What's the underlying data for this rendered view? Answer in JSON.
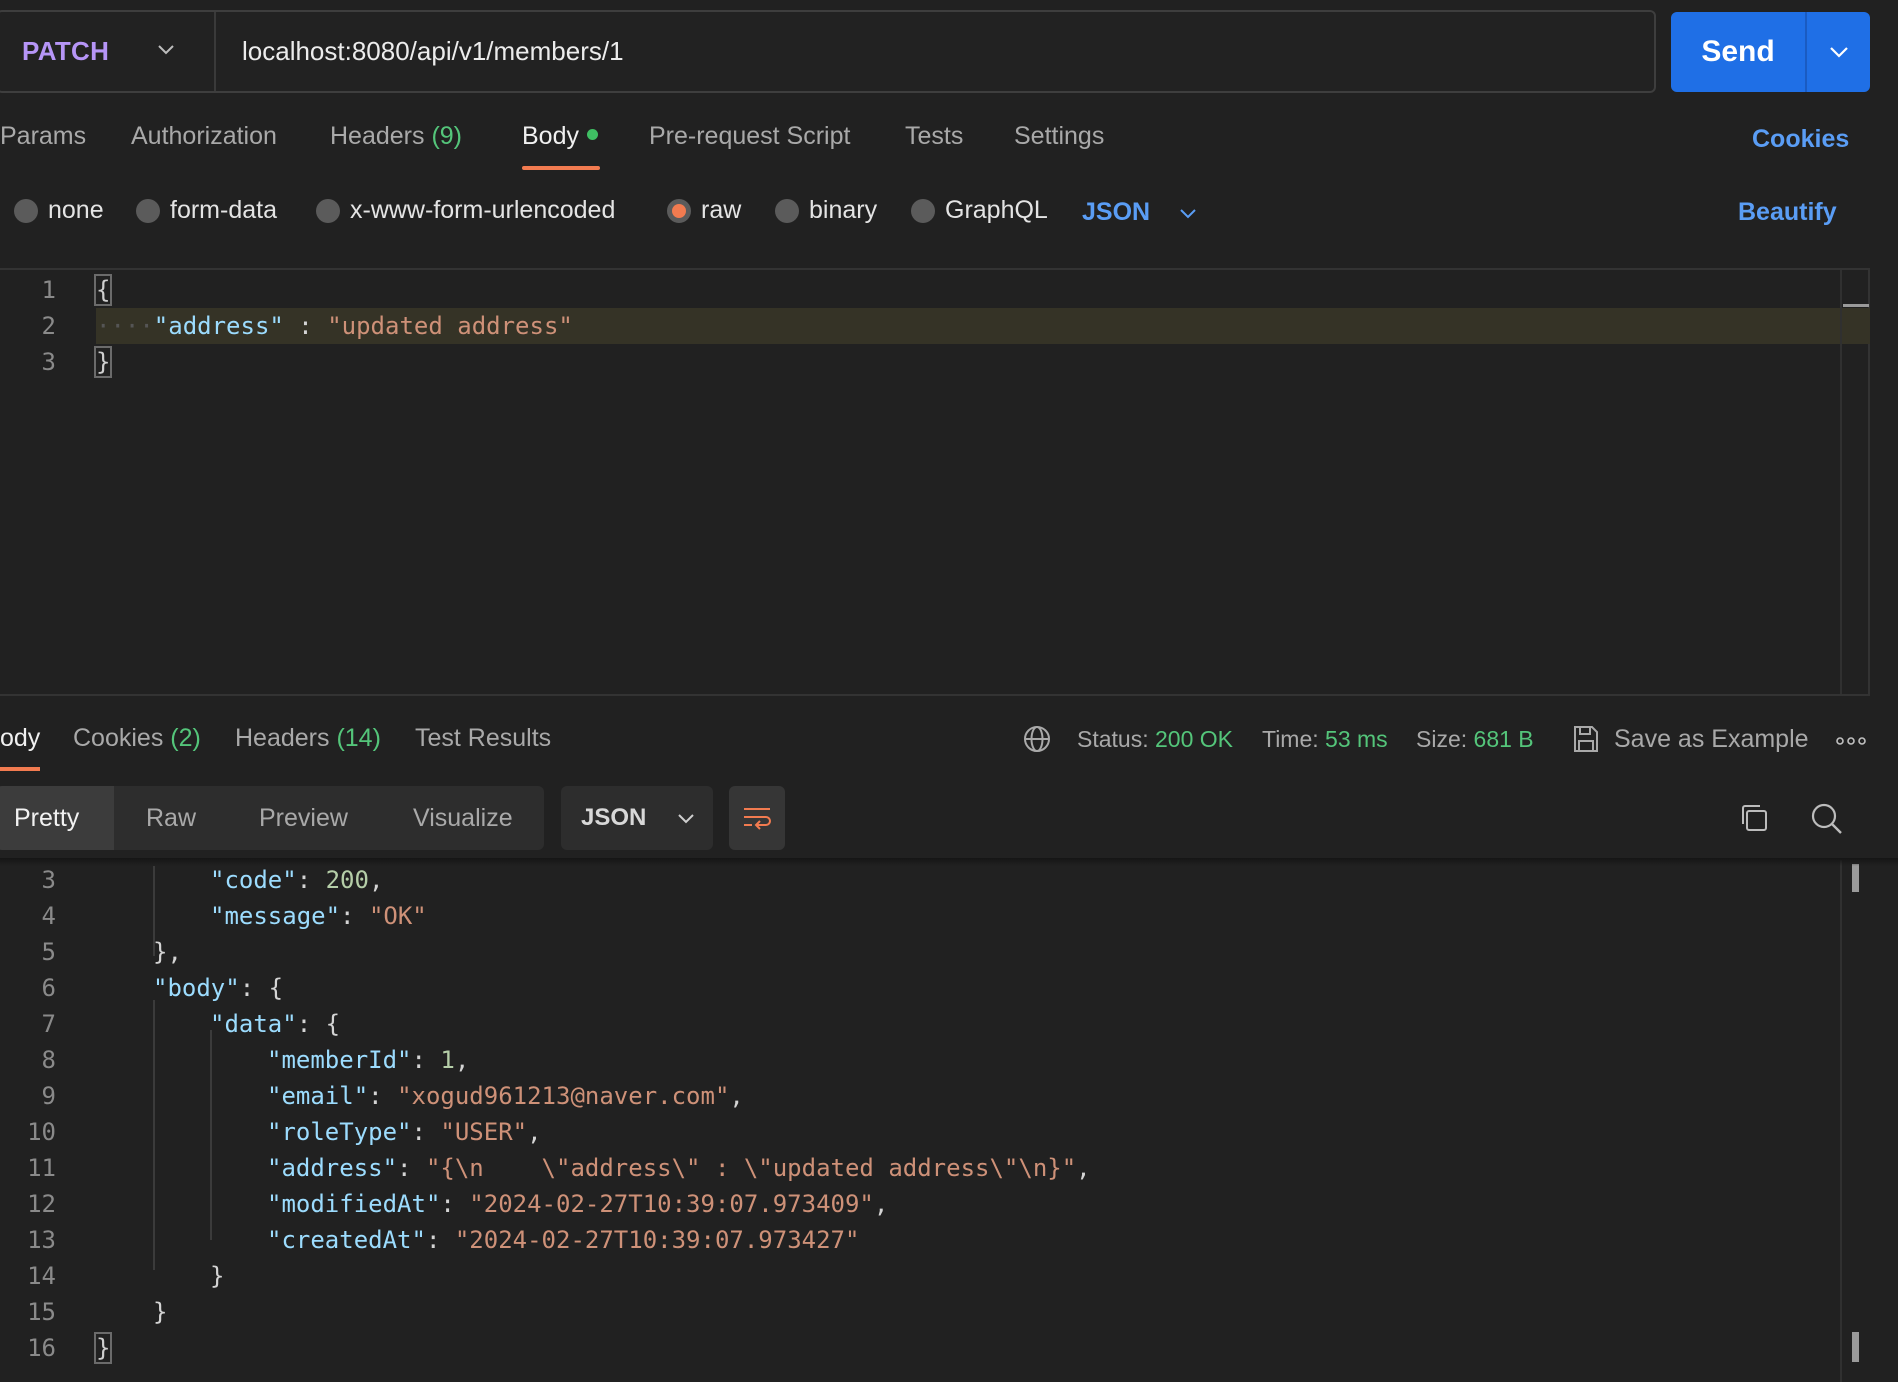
{
  "request": {
    "method": "PATCH",
    "url": "localhost:8080/api/v1/members/1",
    "send_label": "Send"
  },
  "request_tabs": {
    "params": "Params",
    "authorization": "Authorization",
    "headers": "Headers",
    "headers_count": "(9)",
    "body": "Body",
    "pre_request": "Pre-request Script",
    "tests": "Tests",
    "settings": "Settings",
    "cookies": "Cookies"
  },
  "body_types": {
    "none": "none",
    "form_data": "form-data",
    "urlencoded": "x-www-form-urlencoded",
    "raw": "raw",
    "binary": "binary",
    "graphql": "GraphQL",
    "selected": "raw",
    "format": "JSON",
    "beautify": "Beautify"
  },
  "request_body": {
    "line_numbers": [
      "1",
      "2",
      "3"
    ],
    "open_brace": "{",
    "key": "\"address\"",
    "colon": " : ",
    "value": "\"updated address\"",
    "close_brace": "}"
  },
  "response_tabs": {
    "body": "ody",
    "cookies": "Cookies",
    "cookies_count": "(2)",
    "headers": "Headers",
    "headers_count": "(14)",
    "test_results": "Test Results"
  },
  "response_meta": {
    "status_label": "Status:",
    "status_value": "200 OK",
    "time_label": "Time:",
    "time_value": "53 ms",
    "size_label": "Size:",
    "size_value": "681 B",
    "save_example": "Save as Example"
  },
  "response_view": {
    "pretty": "Pretty",
    "raw": "Raw",
    "preview": "Preview",
    "visualize": "Visualize",
    "format": "JSON"
  },
  "response_body": {
    "line_numbers": [
      "3",
      "4",
      "5",
      "6",
      "7",
      "8",
      "9",
      "10",
      "11",
      "12",
      "13",
      "14",
      "15",
      "16"
    ],
    "l3_key": "\"code\"",
    "l3_val": "200",
    "l4_key": "\"message\"",
    "l4_val": "\"OK\"",
    "l5": "},",
    "l6_key": "\"body\"",
    "l6_rest": "{",
    "l7_key": "\"data\"",
    "l7_rest": "{",
    "l8_key": "\"memberId\"",
    "l8_val": "1",
    "l9_key": "\"email\"",
    "l9_val": "\"xogud961213@naver.com\"",
    "l10_key": "\"roleType\"",
    "l10_val": "\"USER\"",
    "l11_key": "\"address\"",
    "l11_val": "\"{\\n    \\\"address\\\" : \\\"updated address\\\"\\n}\"",
    "l12_key": "\"modifiedAt\"",
    "l12_val": "\"2024-02-27T10:39:07.973409\"",
    "l13_key": "\"createdAt\"",
    "l13_val": "\"2024-02-27T10:39:07.973427\"",
    "l14": "}",
    "l15": "}",
    "l16": "}"
  },
  "colors": {
    "method": "#b695f7",
    "send": "#1f6fe6",
    "accent": "#f27b50",
    "link": "#5a9df5",
    "success": "#54c57a",
    "json_key": "#9cdcfe",
    "json_string": "#ce9178",
    "json_number": "#b5cea8"
  },
  "icons": [
    "chevron-down-icon",
    "globe-icon",
    "save-icon",
    "more-icon",
    "wrap-lines-icon",
    "copy-icon",
    "search-icon"
  ]
}
